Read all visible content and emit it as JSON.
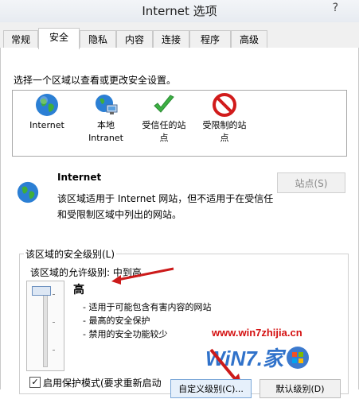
{
  "window": {
    "title": "Internet 选项",
    "help_label": "?"
  },
  "tabs": [
    {
      "label": "常规",
      "active": false
    },
    {
      "label": "安全",
      "active": true
    },
    {
      "label": "隐私",
      "active": false
    },
    {
      "label": "内容",
      "active": false
    },
    {
      "label": "连接",
      "active": false
    },
    {
      "label": "程序",
      "active": false
    },
    {
      "label": "高级",
      "active": false
    }
  ],
  "zones": {
    "prompt": "选择一个区域以查看或更改安全设置。",
    "items": [
      {
        "label": "Internet",
        "icon": "globe-icon",
        "selected": true
      },
      {
        "label": "本地\nIntranet",
        "icon": "intranet-icon",
        "selected": false
      },
      {
        "label": "受信任的站\n点",
        "icon": "checkmark-icon",
        "selected": false
      },
      {
        "label": "受限制的站\n点",
        "icon": "prohibited-icon",
        "selected": false
      }
    ]
  },
  "zone_info": {
    "name": "Internet",
    "description": "该区域适用于 Internet 网站，但不适用于在受信任和受限制区域中列出的网站。",
    "sites_button": "站点(S)"
  },
  "security_level": {
    "group_label": "该区域的安全级别(L)",
    "allowed_levels": "该区域的允许级别: 中到高",
    "level_name": "高",
    "level_position": 1.0,
    "bullets": [
      "- 适用于可能包含有害内容的网站",
      "- 最高的安全保护",
      "- 禁用的安全功能较少"
    ],
    "protected_mode_label": "启用保护模式(要求重新启动",
    "protected_mode_checked": true,
    "custom_button": "自定义级别(C)...",
    "default_button": "默认级别(D)"
  },
  "watermark": {
    "url": "www.win7zhijia.cn",
    "logo_text": "WiN7.家",
    "colors": {
      "url": "#d41010",
      "logo": "#1a63c5"
    }
  }
}
